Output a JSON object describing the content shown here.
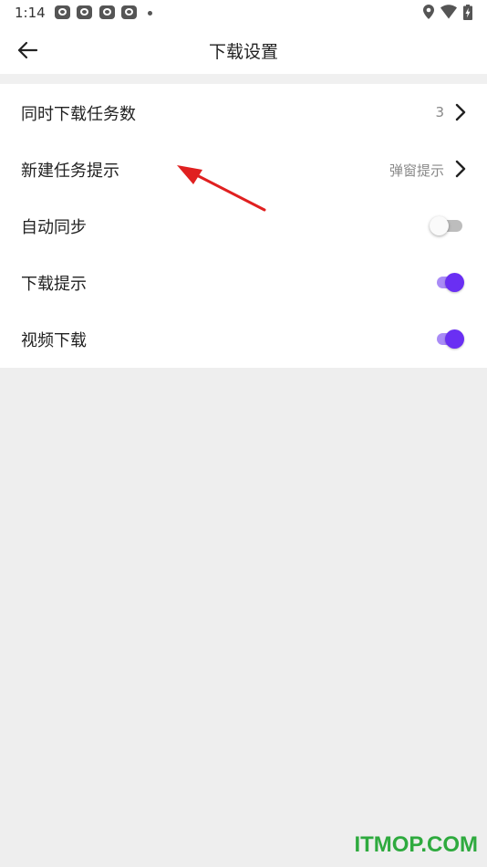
{
  "status_bar": {
    "time": "1:14",
    "notification_icons": [
      "app-notification-icon",
      "app-notification-icon",
      "app-notification-icon",
      "app-notification-icon"
    ],
    "right_icons": [
      "location-icon",
      "wifi-icon",
      "battery-charging-icon"
    ]
  },
  "app_bar": {
    "back_icon": "back-arrow-icon",
    "title": "下载设置"
  },
  "settings": {
    "items": [
      {
        "label": "同时下载任务数",
        "type": "value",
        "value": "3"
      },
      {
        "label": "新建任务提示",
        "type": "value",
        "value": "弹窗提示"
      },
      {
        "label": "自动同步",
        "type": "toggle",
        "enabled": false
      },
      {
        "label": "下载提示",
        "type": "toggle",
        "enabled": true
      },
      {
        "label": "视频下载",
        "type": "toggle",
        "enabled": true
      }
    ]
  },
  "colors": {
    "accent": "#6a2ff3",
    "accent_track": "#a98bf6",
    "annotation": "#e02020",
    "watermark": "#2eaa3e",
    "background": "#eeeeee"
  },
  "watermark": "ITMOP.COM"
}
